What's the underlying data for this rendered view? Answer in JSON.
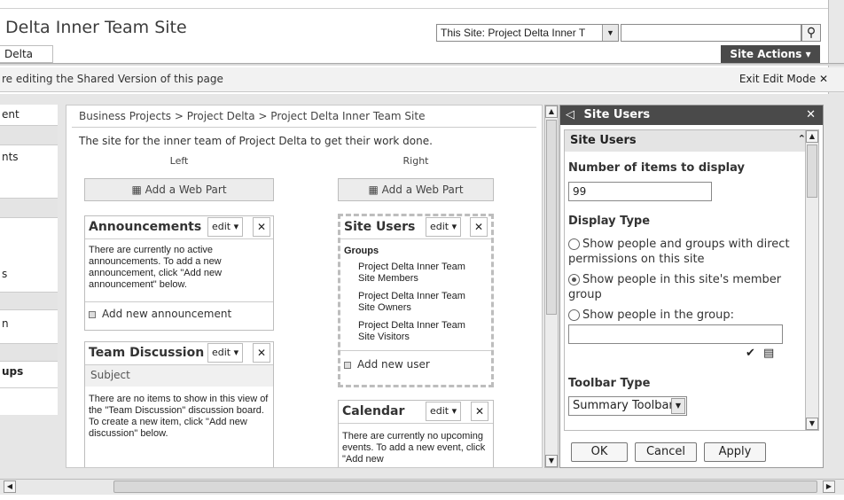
{
  "site": {
    "title": "Delta Inner Team Site",
    "breadcrumb_tab": "Delta"
  },
  "search": {
    "scope": "This Site: Project Delta Inner T",
    "value": ""
  },
  "site_actions": "Site Actions",
  "editbar": {
    "message": "re editing the Shared Version of this page",
    "exit": "Exit Edit Mode"
  },
  "leftnav": [
    "ent",
    "",
    "nts",
    "",
    "",
    "",
    "",
    "s",
    "",
    "n",
    "",
    "ups"
  ],
  "main": {
    "breadcrumb": "Business Projects > Project Delta > Project Delta Inner Team Site",
    "description": "The site for the inner team of Project Delta to get their work done.",
    "left_zone": "Left",
    "right_zone": "Right",
    "add_web_part": "Add a Web Part",
    "edit_label": "edit",
    "announcements": {
      "title": "Announcements",
      "body": "There are currently no active announcements. To add a new announcement, click \"Add new announcement\" below.",
      "link": "Add new announcement"
    },
    "team_discussion": {
      "title": "Team Discussion",
      "column": "Subject",
      "body": "There are no items to show in this view of the \"Team Discussion\" discussion board. To create a new item, click \"Add new discussion\" below."
    },
    "site_users": {
      "title": "Site Users",
      "groups_label": "Groups",
      "groups": [
        "Project Delta Inner Team Site Members",
        "Project Delta Inner Team Site Owners",
        "Project Delta Inner Team Site Visitors"
      ],
      "link": "Add new user"
    },
    "calendar": {
      "title": "Calendar",
      "body": "There are currently no upcoming events. To add a new event, click \"Add new"
    }
  },
  "tool_pane": {
    "title": "Site Users",
    "section": "Site Users",
    "items_label": "Number of items to display",
    "items_value": "99",
    "display_type_label": "Display Type",
    "options": [
      "Show people and groups with direct permissions on this site",
      "Show people in this site's member group",
      "Show people in the group:"
    ],
    "selected_option": 1,
    "toolbar_type_label": "Toolbar Type",
    "toolbar_type_value": "Summary Toolbar",
    "buttons": {
      "ok": "OK",
      "cancel": "Cancel",
      "apply": "Apply"
    }
  }
}
